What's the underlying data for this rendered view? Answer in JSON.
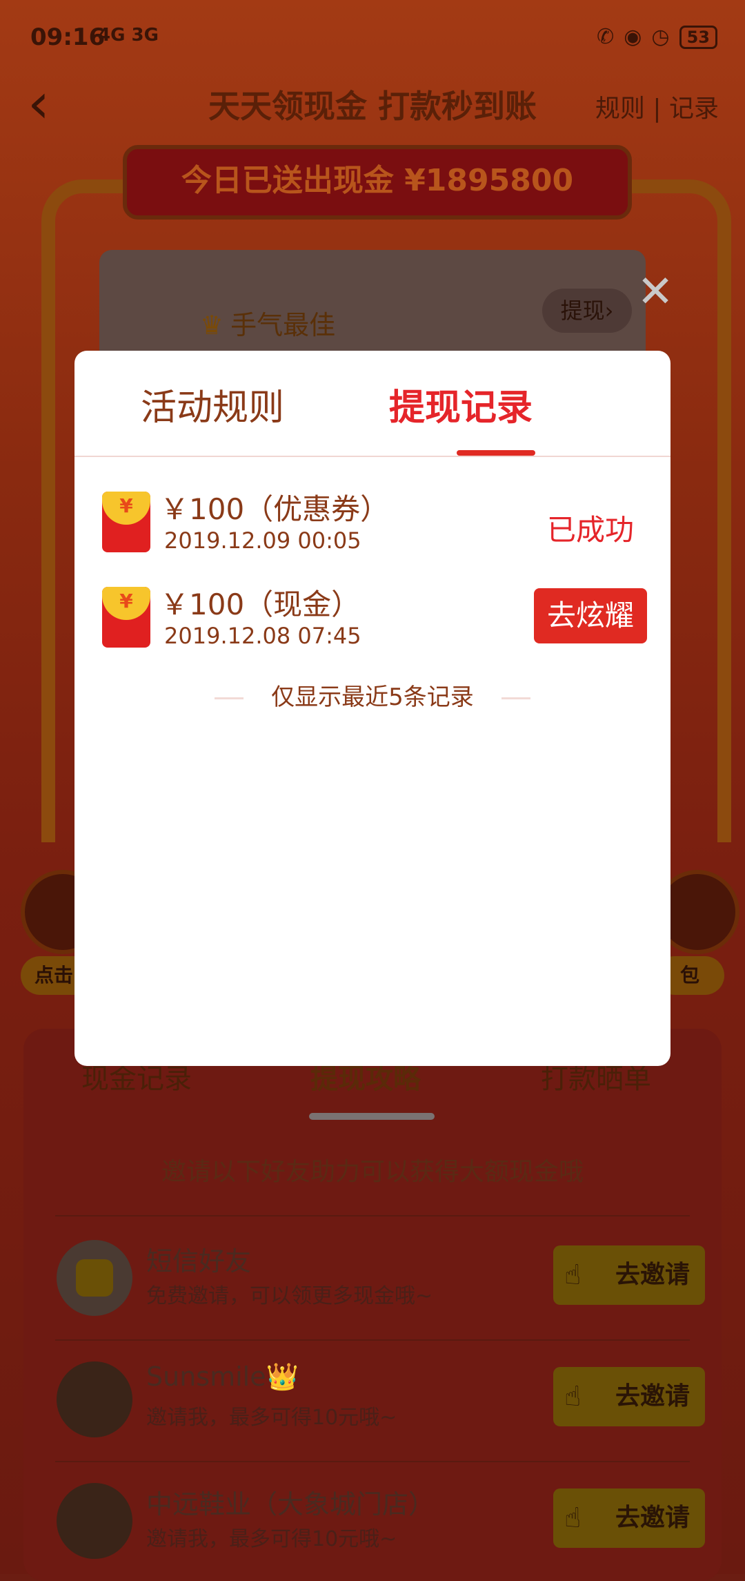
{
  "status_bar": {
    "time": "09:16",
    "network": "4G 3G",
    "battery": "53"
  },
  "nav": {
    "title": "天天领现金 打款秒到账",
    "rules_link": "规则",
    "separator": "|",
    "records_link": "记录"
  },
  "banner": {
    "text": "今日已送出现金 ¥1895800"
  },
  "card": {
    "best_luck": "手气最佳",
    "withdraw": "提现"
  },
  "side": {
    "left_label": "点击",
    "right_label": "包"
  },
  "lower_tabs": [
    "现金记录",
    "提现攻略",
    "打款晒单"
  ],
  "invite_hint": "邀请以下好友助力可以获得大额现金哦",
  "friends": [
    {
      "name": "短信好友",
      "sub": "免费邀请，可以领更多现金哦~",
      "button": "去邀请"
    },
    {
      "name": "Sunsmile👑",
      "sub": "邀请我，最多可得10元哦~",
      "button": "去邀请"
    },
    {
      "name": "中远鞋业（大象城门店）",
      "sub": "邀请我，最多可得10元哦~",
      "button": "去邀请"
    }
  ],
  "modal": {
    "tabs": {
      "rules": "活动规则",
      "records": "提现记录"
    },
    "records": [
      {
        "amount": "￥100（优惠券）",
        "time": "2019.12.09 00:05",
        "status": "已成功"
      },
      {
        "amount": "￥100（现金）",
        "time": "2019.12.08 07:45",
        "button": "去炫耀"
      }
    ],
    "recent_note": "仅显示最近5条记录",
    "yen_symbol": "¥"
  },
  "colors": {
    "accent_red": "#e5252a",
    "brown_text": "#8a3a18",
    "envelope_gold": "#f7c52c"
  }
}
